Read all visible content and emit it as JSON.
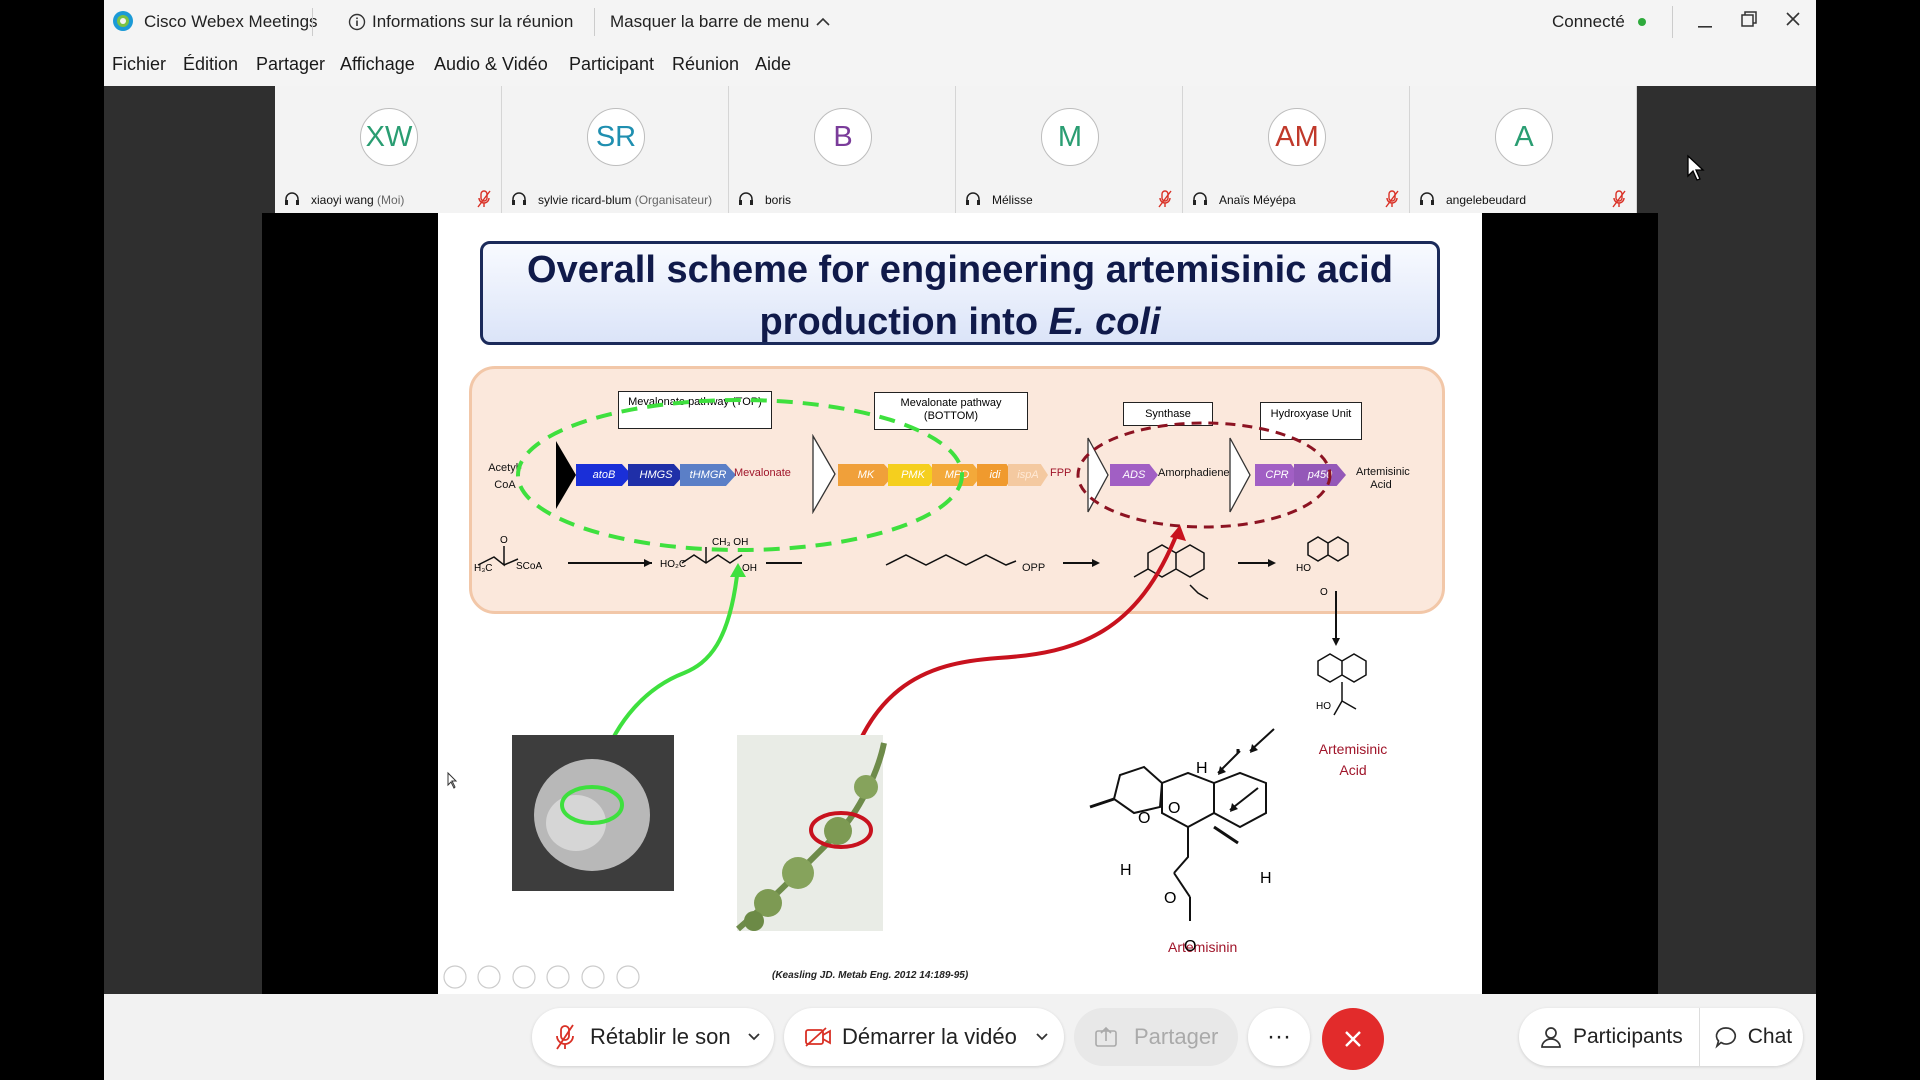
{
  "titlebar": {
    "app_name": "Cisco Webex Meetings",
    "meeting_info": "Informations sur la réunion",
    "hide_menu": "Masquer la barre de menu",
    "status": "Connecté",
    "status_color": "#2eaa3c"
  },
  "menubar": {
    "items": [
      {
        "label": "Fichier",
        "key": "F"
      },
      {
        "label": "Édition",
        "key": "É"
      },
      {
        "label": "Partager",
        "key": "P"
      },
      {
        "label": "Affichage",
        "key": "h"
      },
      {
        "label": "Audio & Vidéo",
        "key": "A"
      },
      {
        "label": "Participant",
        "key": "c"
      },
      {
        "label": "Réunion",
        "key": "R"
      },
      {
        "label": "Aide",
        "key": "A"
      }
    ]
  },
  "participants": [
    {
      "initials": "XW",
      "name": "xiaoyi wang",
      "role": "(Moi)",
      "color": "#2a9d72",
      "muted": true
    },
    {
      "initials": "SR",
      "name": "sylvie ricard-blum",
      "role": "(Organisateur)",
      "color": "#1f8fb0",
      "muted": false
    },
    {
      "initials": "B",
      "name": "boris",
      "role": "",
      "color": "#7a3c9a",
      "muted": false
    },
    {
      "initials": "M",
      "name": "Mélisse",
      "role": "",
      "color": "#2a9d72",
      "muted": true
    },
    {
      "initials": "AM",
      "name": "Anaïs Méyépa",
      "role": "",
      "color": "#c0392b",
      "muted": true
    },
    {
      "initials": "A",
      "name": "angelebeudard",
      "role": "",
      "color": "#2a9d72",
      "muted": true
    }
  ],
  "slide": {
    "title_line1": "Overall scheme for engineering artemisinic acid",
    "title_line2": "production into",
    "title_italic": "E. coli",
    "labels": {
      "mev_top": "Mevalonate pathway (TOP)",
      "mev_bottom": "Mevalonate pathway (BOTTOM)",
      "synthase": "Synthase",
      "hydroxyase": "Hydroxyase Unit",
      "acetyl": "Acetyl-CoA",
      "mevalonate": "Mevalonate",
      "fpp": "FPP",
      "amorphadiene": "Amorphadiene",
      "artemisinic_acid_top": "Artemisinic Acid",
      "artemisinic_acid": "Artemisinic Acid",
      "artemisinin": "Artemisinin",
      "opp": "OPP",
      "citation": "(Keasling JD. Metab Eng. 2012 14:189-95)"
    },
    "genes_top": [
      "atoB",
      "HMGS",
      "tHMGR"
    ],
    "genes_bottom": [
      "MK",
      "PMK",
      "MPD",
      "idi",
      "ispA"
    ],
    "gene_ads": "ADS",
    "genes_hydroxy": [
      "CPR",
      "p450"
    ]
  },
  "bottombar": {
    "unmute": "Rétablir le son",
    "start_video": "Démarrer la vidéo",
    "share": "Partager",
    "more": "···",
    "participants": "Participants",
    "chat": "Chat"
  }
}
